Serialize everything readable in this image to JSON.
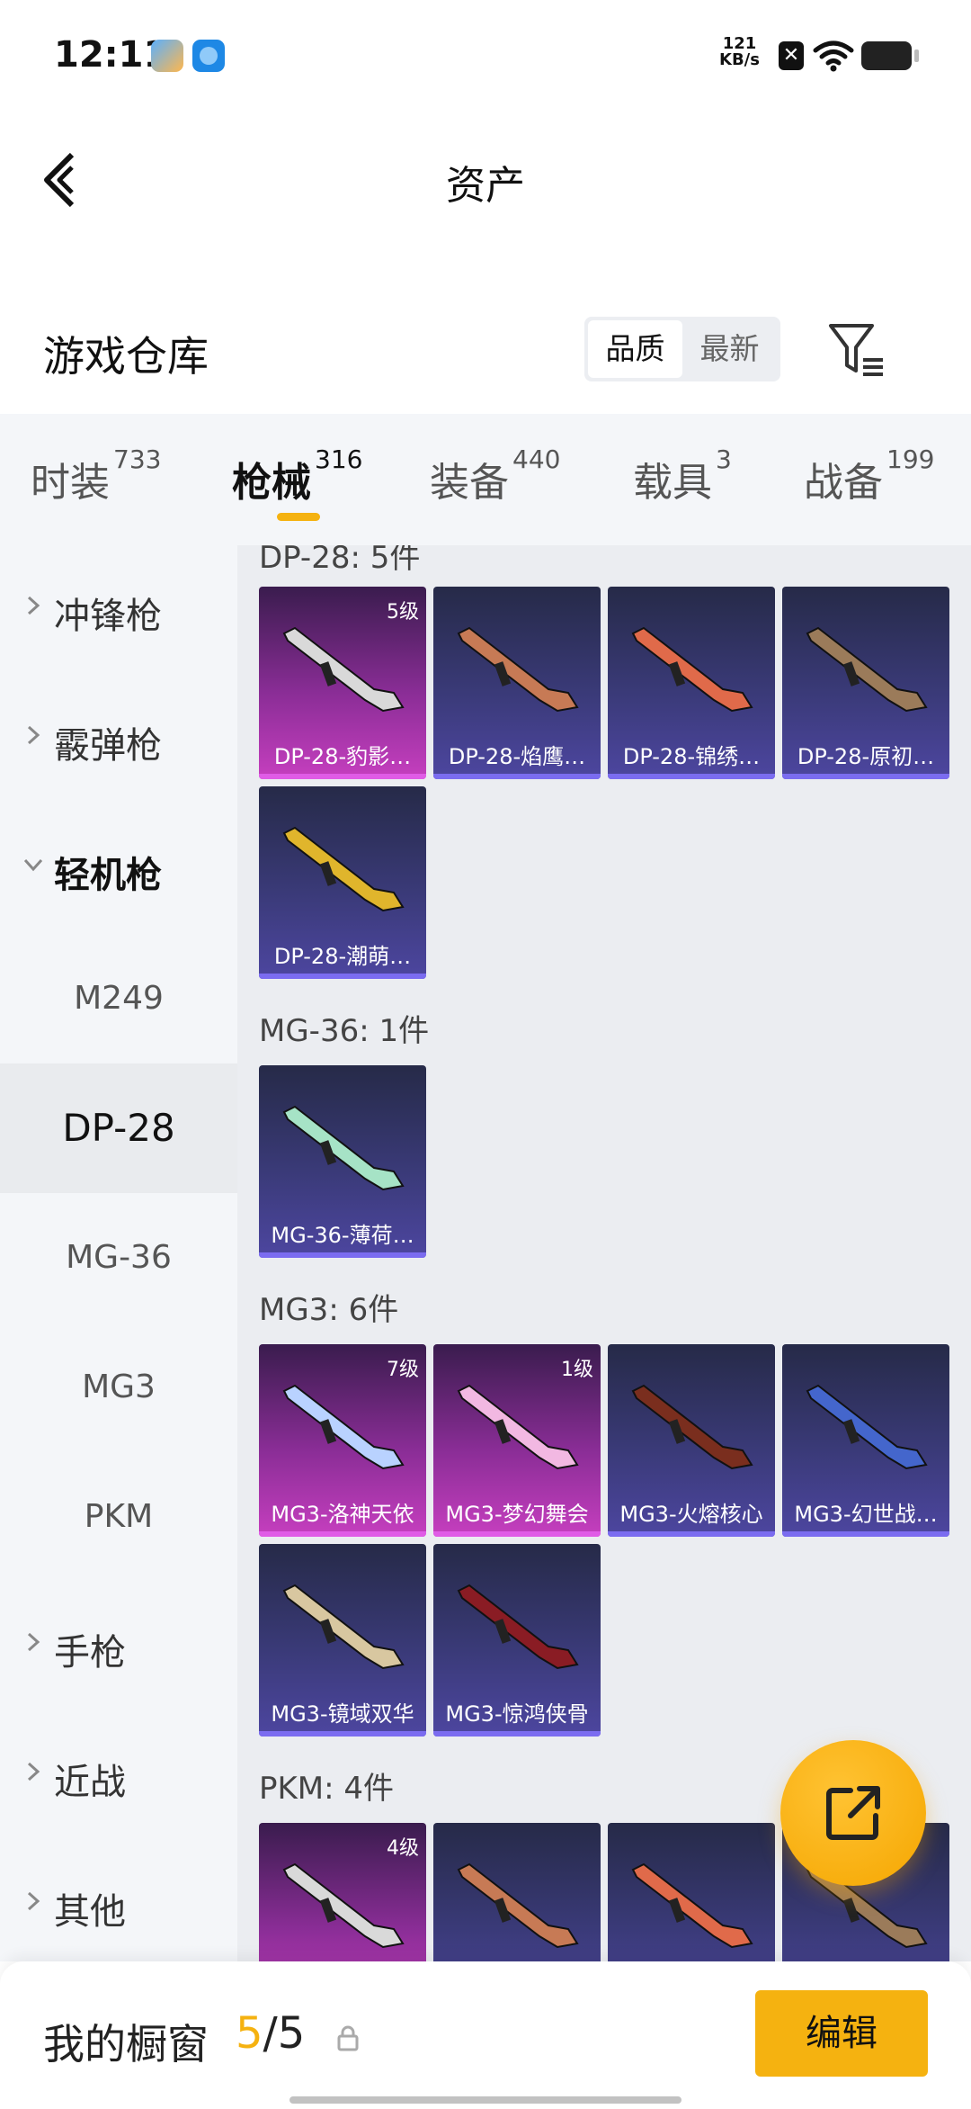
{
  "status_bar": {
    "time": "12:11",
    "speed_value": "121",
    "speed_unit": "KB/s"
  },
  "header": {
    "title": "资产"
  },
  "warehouse": {
    "title": "游戏仓库",
    "sort_options": [
      "品质",
      "最新"
    ],
    "active_sort": "品质"
  },
  "tabs": [
    {
      "label": "时装",
      "count": "733"
    },
    {
      "label": "枪械",
      "count": "316",
      "active": true
    },
    {
      "label": "装备",
      "count": "440"
    },
    {
      "label": "载具",
      "count": "3"
    },
    {
      "label": "战备",
      "count": "199"
    }
  ],
  "sidebar": {
    "cat_smg": "冲锋枪",
    "cat_shotgun": "霰弹枪",
    "cat_lmg": "轻机枪",
    "sub_m249": "M249",
    "sub_dp28": "DP-28",
    "sub_mg36": "MG-36",
    "sub_mg3": "MG3",
    "sub_pkm": "PKM",
    "cat_pistol": "手枪",
    "cat_melee": "近战",
    "cat_other": "其他"
  },
  "groups": {
    "dp28": {
      "header": "DP-28: 5件",
      "items": [
        {
          "name": "DP-28-豹影…",
          "level": "5级",
          "rarity": "pink"
        },
        {
          "name": "DP-28-焰鹰…",
          "rarity": "purple"
        },
        {
          "name": "DP-28-锦绣…",
          "rarity": "purple"
        },
        {
          "name": "DP-28-原初…",
          "rarity": "purple"
        },
        {
          "name": "DP-28-潮萌…",
          "rarity": "purple"
        }
      ]
    },
    "mg36": {
      "header": "MG-36: 1件",
      "items": [
        {
          "name": "MG-36-薄荷…",
          "rarity": "purple"
        }
      ]
    },
    "mg3": {
      "header": "MG3: 6件",
      "items": [
        {
          "name": "MG3-洛神天依",
          "level": "7级",
          "rarity": "pink"
        },
        {
          "name": "MG3-梦幻舞会",
          "level": "1级",
          "rarity": "pink"
        },
        {
          "name": "MG3-火熔核心",
          "rarity": "purple"
        },
        {
          "name": "MG3-幻世战…",
          "rarity": "purple"
        },
        {
          "name": "MG3-镜域双华",
          "rarity": "purple"
        },
        {
          "name": "MG3-惊鸿侠骨",
          "rarity": "purple"
        }
      ]
    },
    "pkm": {
      "header": "PKM: 4件",
      "items": [
        {
          "level": "4级",
          "rarity": "pink"
        },
        {
          "rarity": "purple"
        },
        {
          "rarity": "purple"
        },
        {
          "rarity": "purple"
        }
      ]
    }
  },
  "showcase": {
    "title": "我的橱窗",
    "current": "5",
    "total": "/5",
    "edit_label": "编辑"
  },
  "colors": {
    "accent": "#f5b210",
    "card_purple": "#3a3a78",
    "card_pink": "#c63fbf"
  }
}
